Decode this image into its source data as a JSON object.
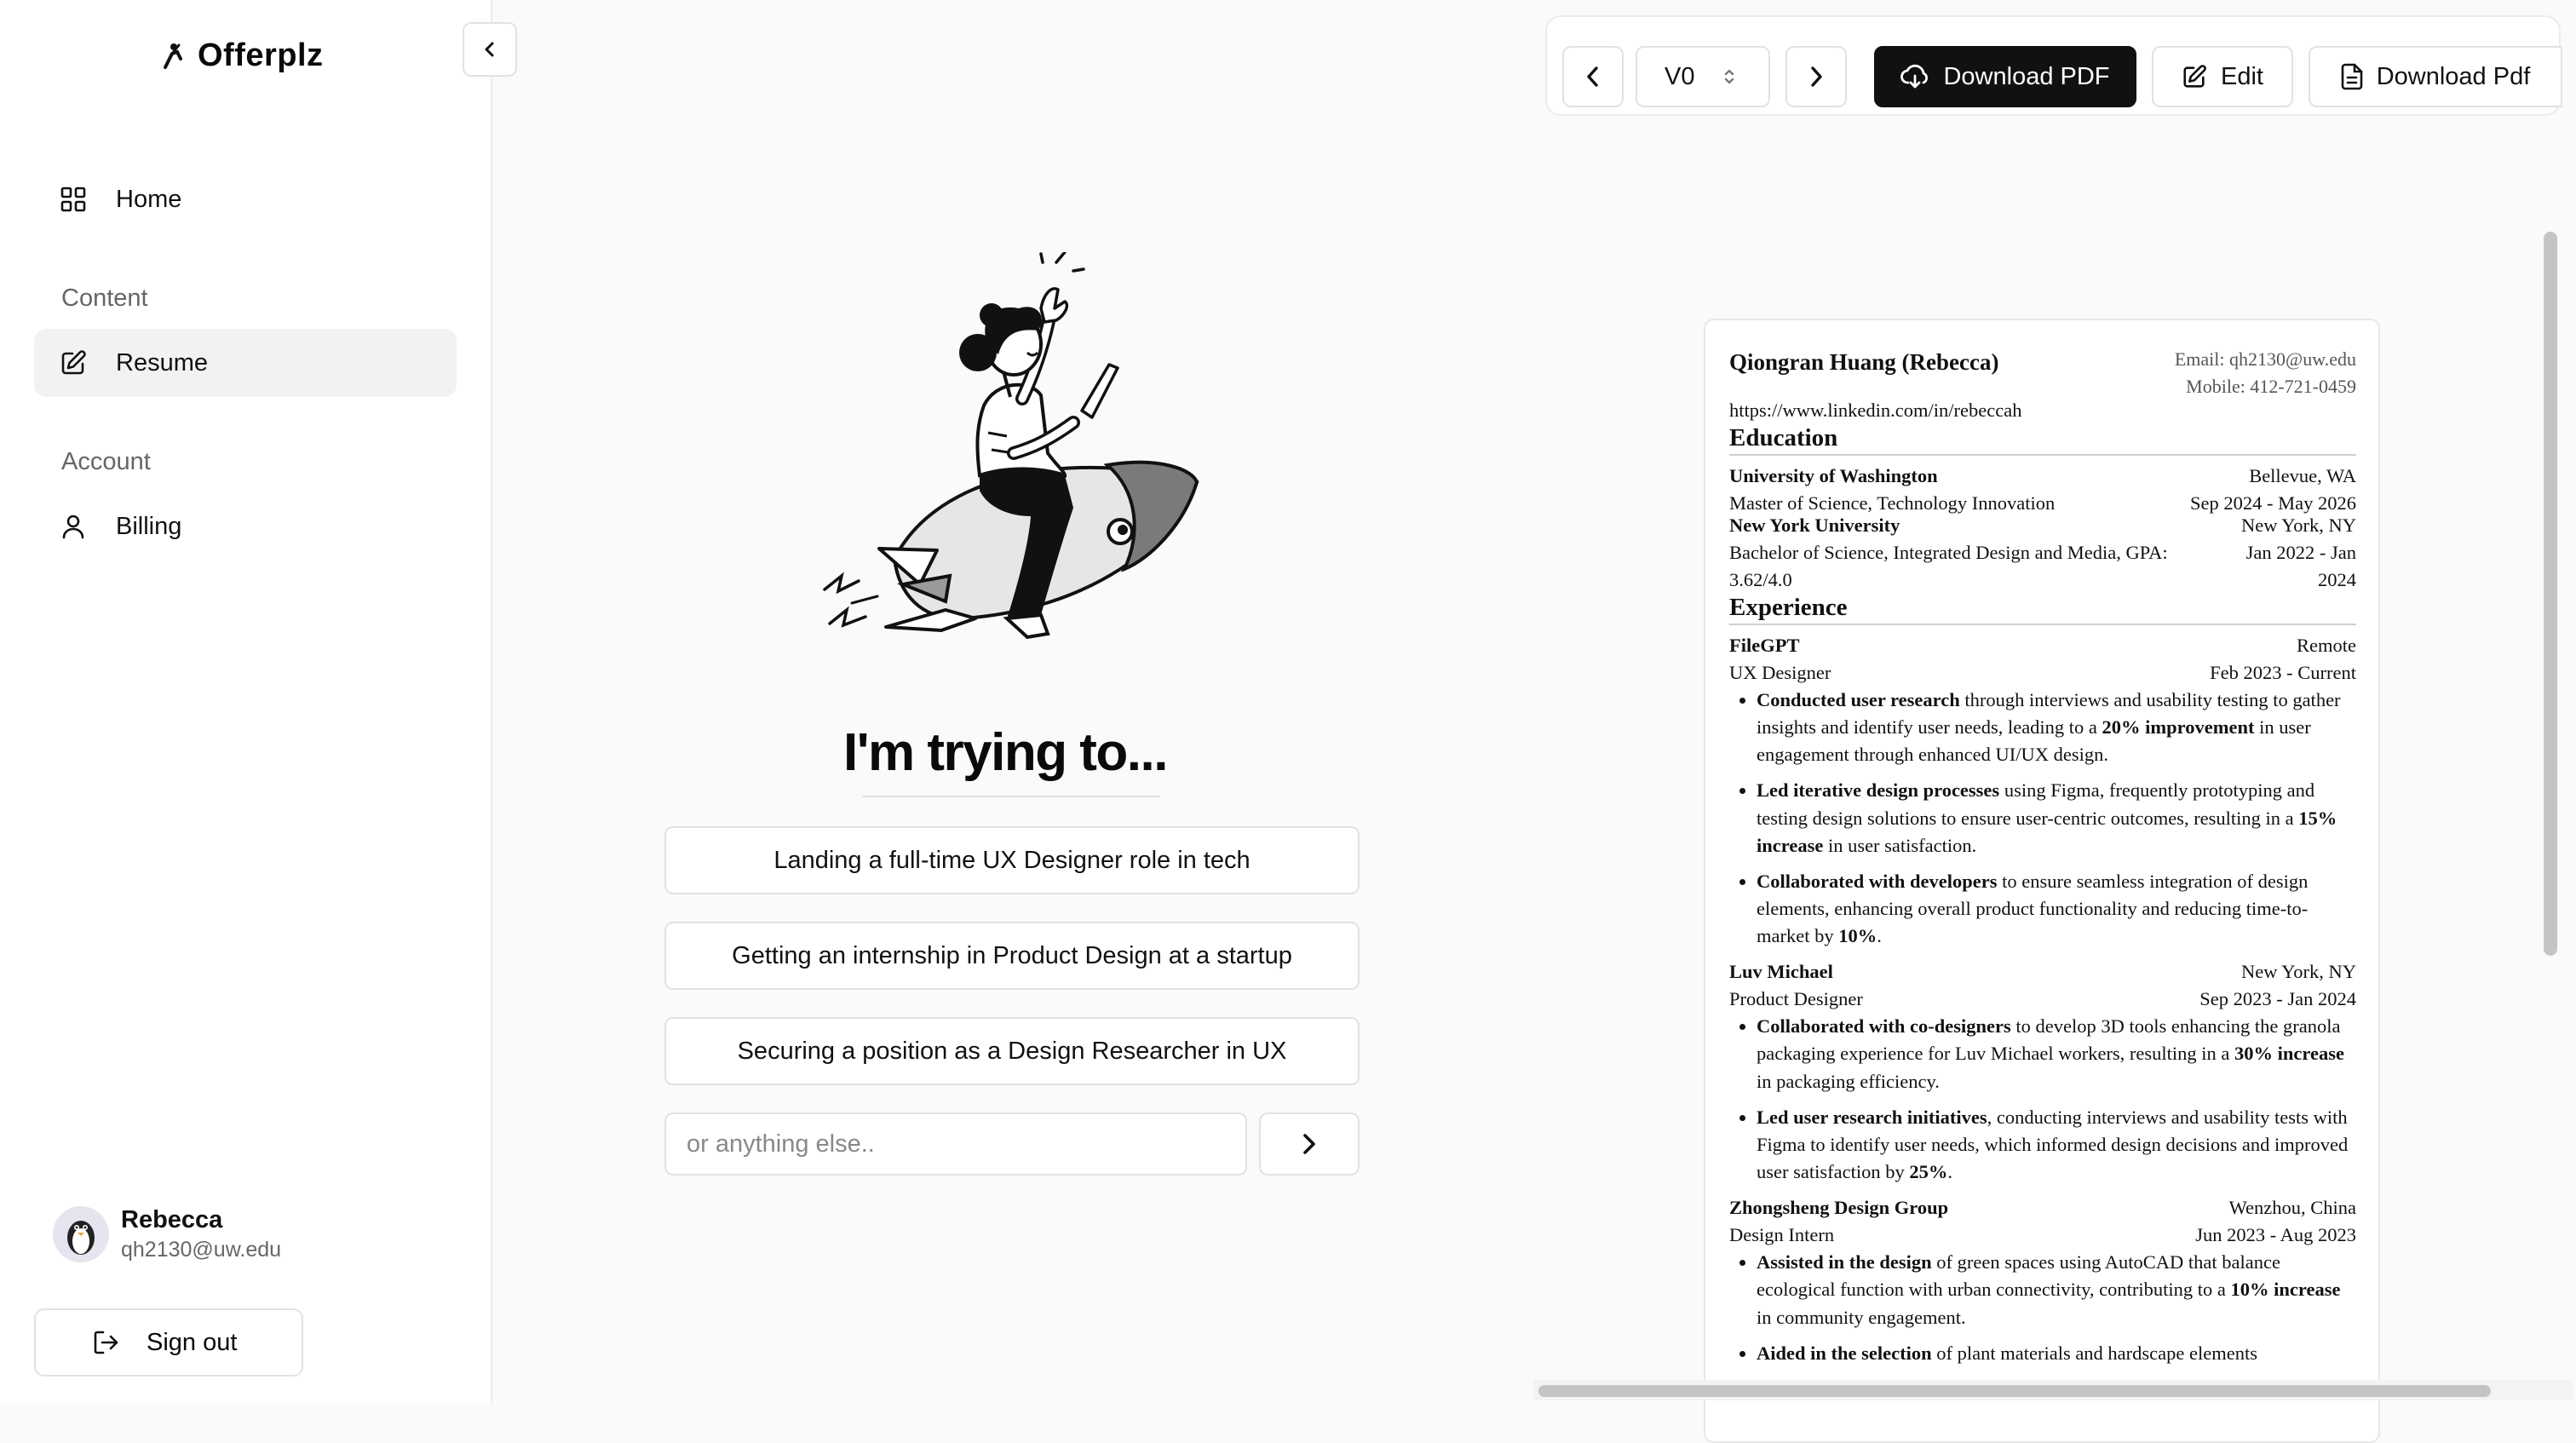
{
  "app": {
    "name": "Offerplz"
  },
  "sidebar": {
    "home_label": "Home",
    "content_section": "Content",
    "resume_label": "Resume",
    "account_section": "Account",
    "billing_label": "Billing",
    "user": {
      "name": "Rebecca",
      "email": "qh2130@uw.edu"
    },
    "signout_label": "Sign out"
  },
  "main": {
    "headline": "I'm trying to...",
    "choices": [
      "Landing a full-time UX Designer role in tech",
      "Getting an internship in Product Design at a startup",
      "Securing a position as a Design Researcher in UX"
    ],
    "input_placeholder": "or anything else.."
  },
  "toolbar": {
    "version": "V0",
    "download_pdf_primary": "Download PDF",
    "edit_label": "Edit",
    "download_pdf_secondary": "Download Pdf"
  },
  "resume": {
    "name": "Qiongran Huang (Rebecca)",
    "email": "Email: qh2130@uw.edu",
    "mobile": "Mobile: 412-721-0459",
    "linkedin": "https://www.linkedin.com/in/rebeccah",
    "education_heading": "Education",
    "education": [
      {
        "school": "University of Washington",
        "location": "Bellevue, WA",
        "degree": "Master of Science, Technology Innovation",
        "dates": "Sep 2024 - May 2026"
      },
      {
        "school": "New York University",
        "location": "New York, NY",
        "degree": "Bachelor of Science, Integrated Design and Media, GPA: 3.62/4.0",
        "dates": "Jan 2022 - Jan 2024"
      }
    ],
    "experience_heading": "Experience",
    "jobs": [
      {
        "company": "FileGPT",
        "location": "Remote",
        "title": "UX Designer",
        "dates": "Feb 2023 - Current",
        "bullets": [
          [
            "Conducted user research",
            " through interviews and usability testing to gather insights and identify user needs, leading to a ",
            "20% improvement",
            " in user engagement through enhanced UI/UX design."
          ],
          [
            "Led iterative design processes",
            " using Figma, frequently prototyping and testing design solutions to ensure user-centric outcomes, resulting in a ",
            "15% increase",
            " in user satisfaction."
          ],
          [
            "Collaborated with developers",
            " to ensure seamless integration of design elements, enhancing overall product functionality and reducing time-to-market by ",
            "10%",
            "."
          ]
        ]
      },
      {
        "company": "Luv Michael",
        "location": "New York, NY",
        "title": "Product Designer",
        "dates": "Sep 2023 - Jan 2024",
        "bullets": [
          [
            "Collaborated with co-designers",
            " to develop 3D tools enhancing the granola packaging experience for Luv Michael workers, resulting in a ",
            "30% increase",
            " in packaging efficiency."
          ],
          [
            "Led user research initiatives",
            ", conducting interviews and usability tests with Figma to identify user needs, which informed design decisions and improved user satisfaction by ",
            "25%",
            "."
          ]
        ]
      },
      {
        "company": "Zhongsheng Design Group",
        "location": "Wenzhou, China",
        "title": "Design Intern",
        "dates": "Jun 2023 - Aug 2023",
        "bullets": [
          [
            "Assisted in the design",
            " of green spaces using AutoCAD that balance ecological function with urban connectivity, contributing to a ",
            "10% increase",
            " in community engagement."
          ],
          [
            "Aided in the selection",
            " of plant materials and hardscape elements",
            "",
            ""
          ]
        ]
      }
    ]
  }
}
